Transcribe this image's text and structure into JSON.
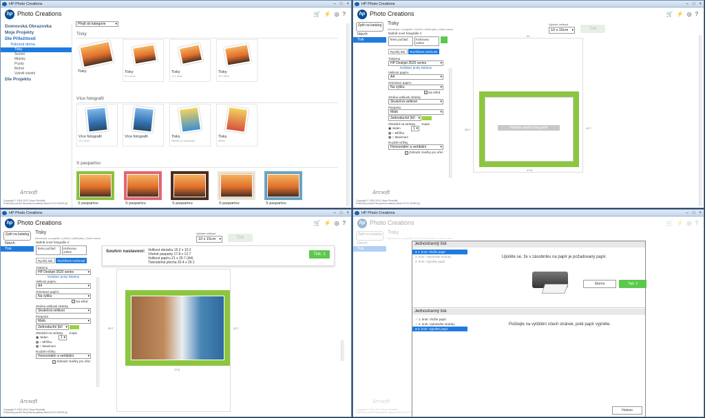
{
  "app": {
    "window_title": "HP Photo Creations",
    "title": "Photo Creations",
    "logo": "hp"
  },
  "toolbar_icons": [
    "cart-icon",
    "lightning-icon",
    "globe-icon",
    "help-icon"
  ],
  "win_controls": [
    "–",
    "□",
    "×"
  ],
  "w1": {
    "nav": [
      {
        "label": "Domovská Obrazovka",
        "level": 1
      },
      {
        "label": "Moje Projekty",
        "level": 1
      },
      {
        "label": "Dle Příležitosti",
        "level": 1,
        "active": true
      },
      {
        "label": "Tisknout doma",
        "level": 2
      },
      {
        "label": "Tisky",
        "level": 3,
        "selected": true
      },
      {
        "label": "Sezóní",
        "level": 3
      },
      {
        "label": "Mlánky",
        "level": 3
      },
      {
        "label": "Pozdy",
        "level": 3
      },
      {
        "label": "Běžné",
        "level": 3
      },
      {
        "label": "Vykolit vlastní",
        "level": 3
      },
      {
        "label": "Dle Projektu",
        "level": 1
      }
    ],
    "category_select": "Přejít do kategorie",
    "sections": [
      {
        "title": "Tisky",
        "cards": [
          {
            "label": "Tisky",
            "sub": ""
          },
          {
            "label": "Tisky",
            "sub": "10 x 15cm"
          },
          {
            "label": "Tisky",
            "sub": "13 x 18cm"
          },
          {
            "label": "Tisky",
            "sub": "20 x 25cm"
          }
        ]
      },
      {
        "title": "Více fotografií",
        "cards": [
          {
            "label": "Více fotografií",
            "sub": "10 x 15cm"
          },
          {
            "label": "Více fotografií",
            "sub": ""
          },
          {
            "label": "Tisky",
            "sub": "Hledání po pozdrávky"
          },
          {
            "label": "Tisky",
            "sub": "M50m"
          }
        ]
      },
      {
        "title": "S paspartou",
        "cards": [
          {
            "label": "S paspartou",
            "sub": "",
            "color": "#8cc63f"
          },
          {
            "label": "S paspartou",
            "sub": "",
            "color": "#e8667a"
          },
          {
            "label": "S paspartou",
            "sub": "",
            "color": "#4a2e1e"
          },
          {
            "label": "S paspartou",
            "sub": "",
            "color": "#f0e6d6"
          },
          {
            "label": "S paspartou",
            "sub": "",
            "color": "#6aa8c8"
          }
        ]
      }
    ]
  },
  "copyright": "Copyright © 2004-2012 Visan Photolife",
  "copy_links": "Podmínky použití  Nevyřízené patenty  Build 10712 39190 (s)",
  "signature": "Arcsoft",
  "print_ui": {
    "back": "Zpět na katalog",
    "title": "Tisky",
    "breadcrumb": "Informace o projektu | Uložit | Uložit jako | Začít znovu",
    "size_label": "Vyberte velikost",
    "size_value": "10 x 15cm",
    "tisk_disabled": "Tisk",
    "left_nav": [
      "Návrh",
      "Tisk"
    ],
    "add_photos": "Nahrát nové fotografie z:",
    "src1": "Tento počítač",
    "src2": "Knihovna online",
    "tab1": "Rychlý tisk",
    "tab2": "Rozšířené možnosti",
    "printer_label": "Tiskárna",
    "printer": "HP Deskjet 3520 series",
    "printer_link": "Ovládací prvky tiskárny",
    "paper_label": "Velikost papíru",
    "paper": "A4",
    "orient_label": "Orientace papíru",
    "orient": "Na výšku",
    "center": "Na střed",
    "scale_label": "Změna velikosti stránky",
    "scale": "Skutečná velikost",
    "pasp_label": "Pasparta",
    "pasp": "Malá",
    "pasp2": "Jednoduché (bíl",
    "perpage_label": "Obrázků na stránku",
    "copies_label": "Kopie",
    "copies": "1",
    "opt1": "Jeden",
    "opt2": "Mřížka",
    "opt3": "Maximum",
    "layout_label": "Rozběl mřížky",
    "layout": "Horizontální a vertikální",
    "cutmarks": "Zobrazit značky pro ořez"
  },
  "w2": {
    "drop_text": "Přidejte vlastní fotografie",
    "width": "21",
    "height": "29.7",
    "inner_h": "12.7",
    "inner_w": "17.8"
  },
  "w3": {
    "summary_title": "Souhrn nastavení:",
    "summary": [
      "Velikost obrázku 15.2 x 10.2",
      "Všetně pasparty 17.8 x 12.7",
      "Velikost papíru 21 x 29.7 (A4)",
      "Tisknutelná plocha 20.4 x 29.1"
    ],
    "tisk_btn": "Tisk: 1",
    "width": "17.8",
    "height": "29.7",
    "inner_h": "12.7"
  },
  "w4": {
    "m1_title": "Jednostranný tisk",
    "m1_steps": [
      "1. krok: Vložte papír",
      "2. krok: Vytiskněte stránky",
      "3. krok: Vyjměte papír"
    ],
    "m1_msg": "Ujistěte se, že v zásobníku na papír je požadovaný papír.",
    "m1_cancel": "Storno",
    "m1_ok": "Tisk: 1",
    "m2_title": "Jednostranný tisk",
    "m2_steps": [
      "1. krok: Vložte papír",
      "2. krok: Vytiskněte stránky",
      "3. krok: Vyjměte papír"
    ],
    "m2_msg": "Počkejte na vytištění všech stránek, poté papír vyjměte.",
    "m2_done": "Hotovo"
  }
}
